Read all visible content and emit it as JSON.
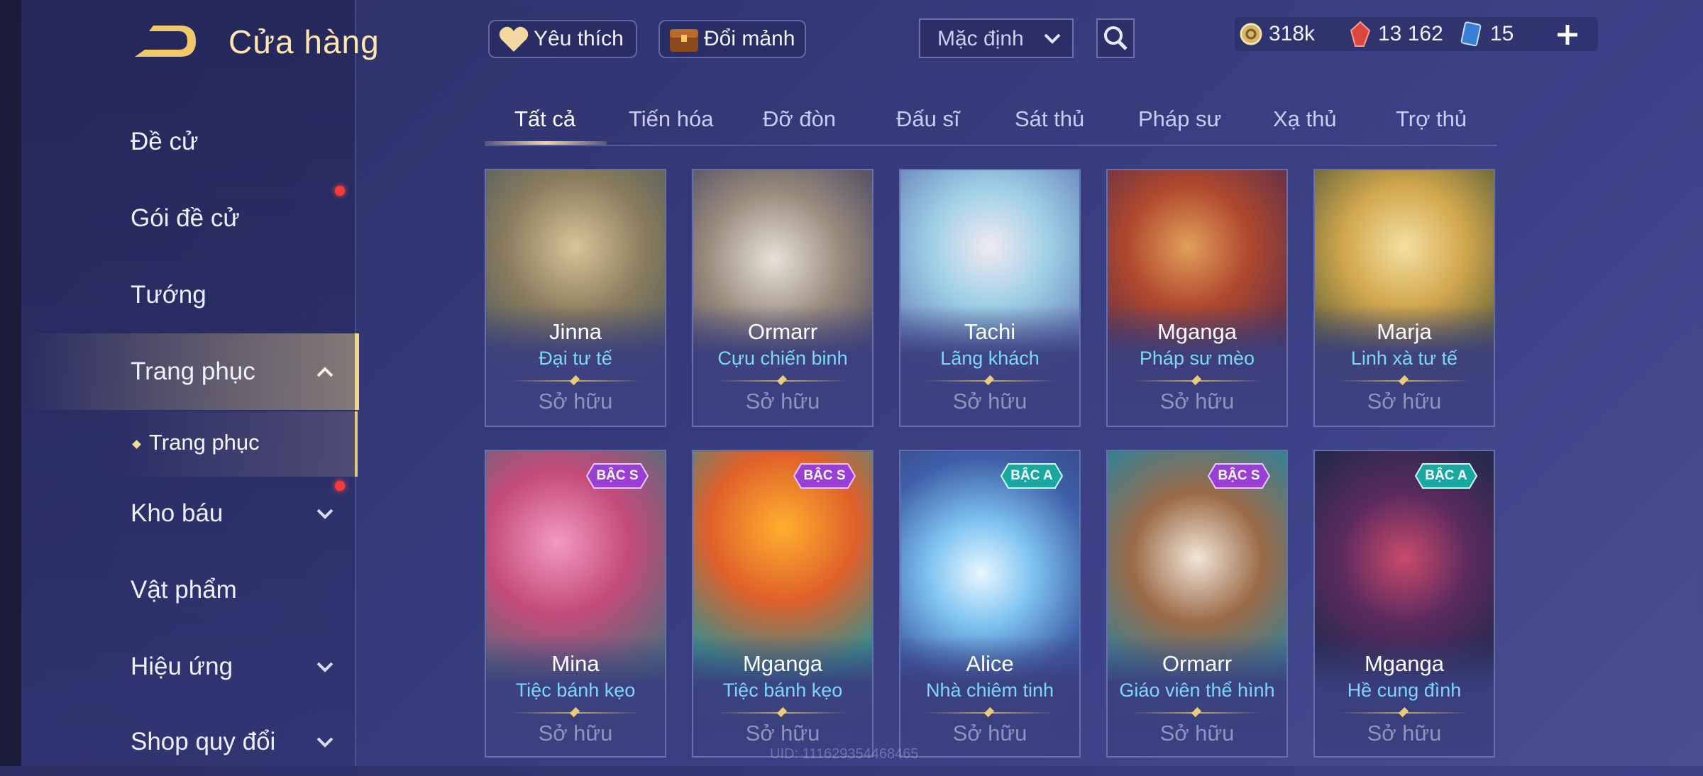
{
  "header": {
    "title": "Cửa hàng",
    "favorite_label": "Yêu thích",
    "exchange_label": "Đổi mảnh",
    "sort_value": "Mặc định",
    "currencies": [
      {
        "name": "gold",
        "value": "318k",
        "icon": "gold-coin-icon"
      },
      {
        "name": "gem",
        "value": "13 162",
        "icon": "red-gem-icon"
      },
      {
        "name": "ticket",
        "value": "15",
        "icon": "blue-card-icon"
      }
    ]
  },
  "sidebar": {
    "items": [
      {
        "label": "Đề cử"
      },
      {
        "label": "Gói đề cử"
      },
      {
        "label": "Tướng"
      },
      {
        "label": "Trang phục"
      },
      {
        "label": "Kho báu"
      },
      {
        "label": "Vật phẩm"
      },
      {
        "label": "Hiệu ứng"
      },
      {
        "label": "Shop quy đổi"
      }
    ],
    "sub_item": {
      "label": "Trang phục"
    }
  },
  "tabs": [
    {
      "label": "Tất cả"
    },
    {
      "label": "Tiến hóa"
    },
    {
      "label": "Đỡ đòn"
    },
    {
      "label": "Đấu sĩ"
    },
    {
      "label": "Sát thủ"
    },
    {
      "label": "Pháp sư"
    },
    {
      "label": "Xạ thủ"
    },
    {
      "label": "Trợ thủ"
    }
  ],
  "cards": [
    {
      "hero": "Jinna",
      "skin": "Đại tư tế",
      "status": "Sở hữu",
      "tier": ""
    },
    {
      "hero": "Ormarr",
      "skin": "Cựu chiến binh",
      "status": "Sở hữu",
      "tier": ""
    },
    {
      "hero": "Tachi",
      "skin": "Lãng khách",
      "status": "Sở hữu",
      "tier": ""
    },
    {
      "hero": "Mganga",
      "skin": "Pháp sư mèo",
      "status": "Sở hữu",
      "tier": ""
    },
    {
      "hero": "Marja",
      "skin": "Linh xà tư tế",
      "status": "Sở hữu",
      "tier": ""
    },
    {
      "hero": "Mina",
      "skin": "Tiệc bánh kẹo",
      "status": "Sở hữu",
      "tier": "BẬC S"
    },
    {
      "hero": "Mganga",
      "skin": "Tiệc bánh kẹo",
      "status": "Sở hữu",
      "tier": "BẬC S"
    },
    {
      "hero": "Alice",
      "skin": "Nhà chiêm tinh",
      "status": "Sở hữu",
      "tier": "BẬC A"
    },
    {
      "hero": "Ormarr",
      "skin": "Giáo viên thể hình",
      "status": "Sở hữu",
      "tier": "BẬC S"
    },
    {
      "hero": "Mganga",
      "skin": "Hề cung đình",
      "status": "Sở hữu",
      "tier": "BẬC A"
    }
  ],
  "footer": {
    "uid": "UID: 111629354468465"
  },
  "colors": {
    "accent_gold": "#f4d792",
    "skin_name": "#7ed7f5",
    "tier_s": "#9a3fd6",
    "tier_a": "#1aa7a0",
    "notify_dot": "#ff3a3a"
  }
}
